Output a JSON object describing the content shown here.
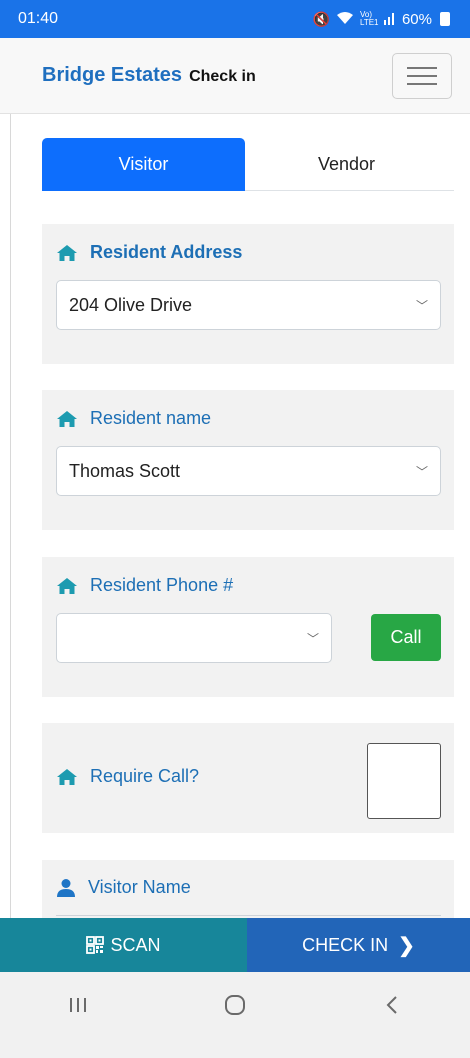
{
  "status_bar": {
    "time": "01:40",
    "battery": "60%",
    "network_label": "Vo) LTE1"
  },
  "header": {
    "brand": "Bridge Estates",
    "subtitle": "Check in"
  },
  "tabs": [
    {
      "label": "Visitor",
      "active": true
    },
    {
      "label": "Vendor",
      "active": false
    }
  ],
  "resident_address": {
    "label": "Resident Address",
    "value": "204 Olive Drive"
  },
  "resident_name": {
    "label": "Resident name",
    "value": "Thomas Scott"
  },
  "resident_phone": {
    "label": "Resident Phone #",
    "value": "",
    "call_label": "Call"
  },
  "require_call": {
    "label": "Require Call?",
    "checked": false
  },
  "visitor_name": {
    "label": "Visitor Name"
  },
  "actions": {
    "scan_label": "SCAN",
    "checkin_label": "CHECK IN"
  },
  "colors": {
    "accent": "#0d6efd",
    "brand": "#1f6fbf",
    "call": "#28a745",
    "scan": "#17869a",
    "checkin": "#2265b8"
  },
  "icons": {
    "section": "home-icon",
    "visitor": "user-icon",
    "scan": "qr-code-icon",
    "checkin": "chevron-right-icon"
  }
}
